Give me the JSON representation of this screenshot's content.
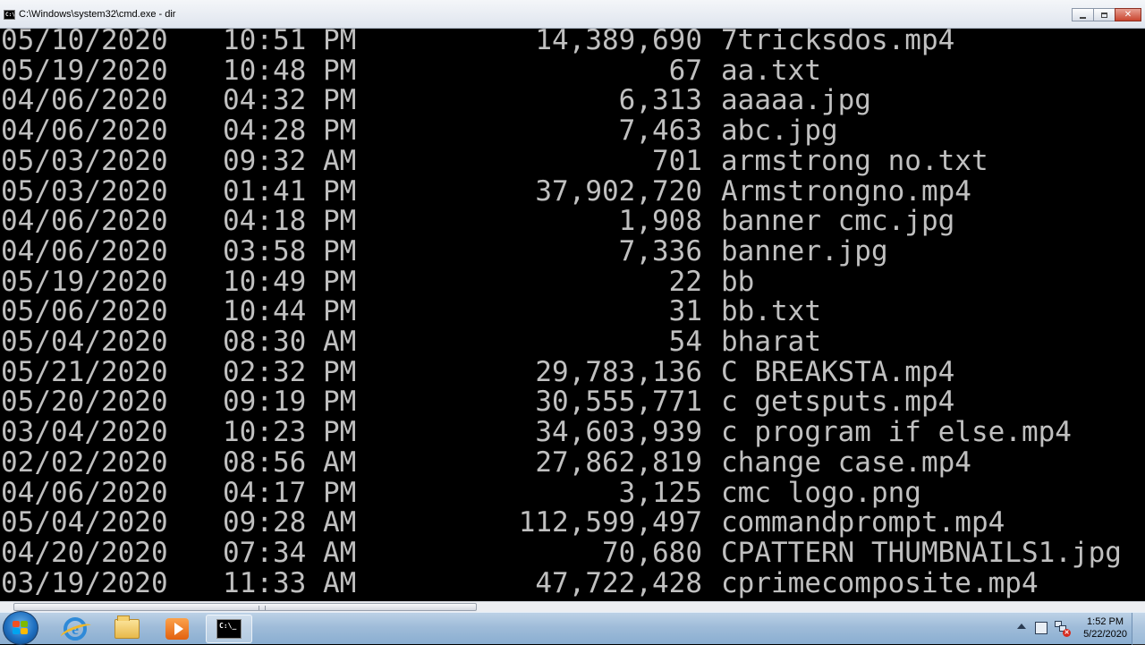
{
  "window": {
    "title": "C:\\Windows\\system32\\cmd.exe - dir",
    "icon_label": "C:\\"
  },
  "listing": [
    {
      "date": "05/10/2020",
      "time": "10:51 PM",
      "size": "14,389,690",
      "name": "7tricksdos.mp4"
    },
    {
      "date": "05/19/2020",
      "time": "10:48 PM",
      "size": "67",
      "name": "aa.txt"
    },
    {
      "date": "04/06/2020",
      "time": "04:32 PM",
      "size": "6,313",
      "name": "aaaaa.jpg"
    },
    {
      "date": "04/06/2020",
      "time": "04:28 PM",
      "size": "7,463",
      "name": "abc.jpg"
    },
    {
      "date": "05/03/2020",
      "time": "09:32 AM",
      "size": "701",
      "name": "armstrong no.txt"
    },
    {
      "date": "05/03/2020",
      "time": "01:41 PM",
      "size": "37,902,720",
      "name": "Armstrongno.mp4"
    },
    {
      "date": "04/06/2020",
      "time": "04:18 PM",
      "size": "1,908",
      "name": "banner cmc.jpg"
    },
    {
      "date": "04/06/2020",
      "time": "03:58 PM",
      "size": "7,336",
      "name": "banner.jpg"
    },
    {
      "date": "05/19/2020",
      "time": "10:49 PM",
      "size": "22",
      "name": "bb"
    },
    {
      "date": "05/06/2020",
      "time": "10:44 PM",
      "size": "31",
      "name": "bb.txt"
    },
    {
      "date": "05/04/2020",
      "time": "08:30 AM",
      "size": "54",
      "name": "bharat"
    },
    {
      "date": "05/21/2020",
      "time": "02:32 PM",
      "size": "29,783,136",
      "name": "C BREAKSTA.mp4"
    },
    {
      "date": "05/20/2020",
      "time": "09:19 PM",
      "size": "30,555,771",
      "name": "c getsputs.mp4"
    },
    {
      "date": "03/04/2020",
      "time": "10:23 PM",
      "size": "34,603,939",
      "name": "c program if else.mp4"
    },
    {
      "date": "02/02/2020",
      "time": "08:56 AM",
      "size": "27,862,819",
      "name": "change case.mp4"
    },
    {
      "date": "04/06/2020",
      "time": "04:17 PM",
      "size": "3,125",
      "name": "cmc logo.png"
    },
    {
      "date": "05/04/2020",
      "time": "09:28 AM",
      "size": "112,599,497",
      "name": "commandprompt.mp4"
    },
    {
      "date": "04/20/2020",
      "time": "07:34 AM",
      "size": "70,680",
      "name": "CPATTERN THUMBNAILS1.jpg"
    },
    {
      "date": "03/19/2020",
      "time": "11:33 AM",
      "size": "47,722,428",
      "name": "cprimecomposite.mp4"
    }
  ],
  "taskbar": {
    "time": "1:52 PM",
    "date": "5/22/2020",
    "cmd_icon_label": "C:\\_"
  },
  "colors": {
    "console_bg": "#000000",
    "console_text": "#c0c0c0",
    "close_button": "#c9442e"
  }
}
